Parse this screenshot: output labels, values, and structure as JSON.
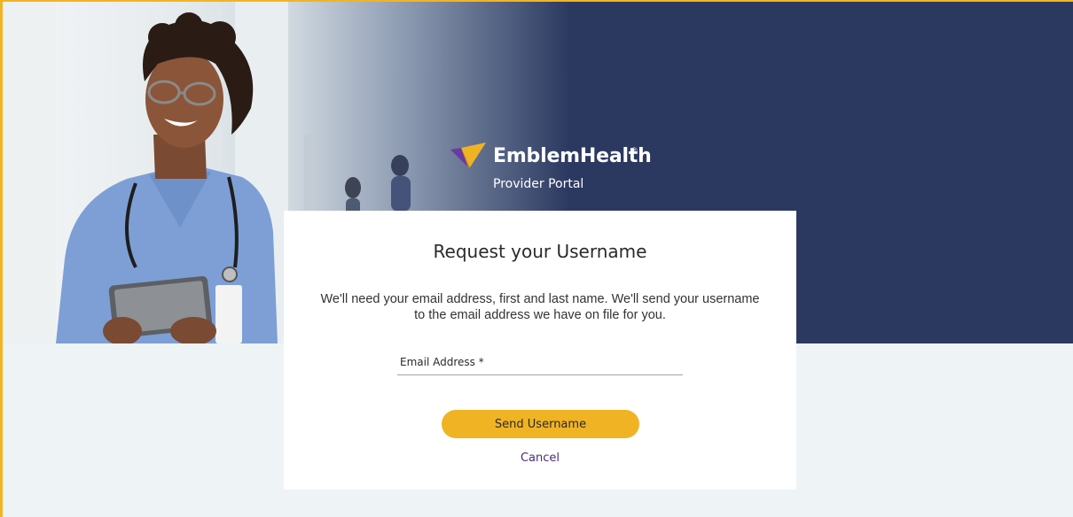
{
  "brand": {
    "name": "EmblemHealth",
    "registered_mark": "®",
    "subtitle": "Provider Portal",
    "colors": {
      "navy": "#2b3961",
      "gold": "#f0b323",
      "purple": "#4b2a7a"
    },
    "logo_icon": "emblem-logo-icon"
  },
  "hero": {
    "photo": "hero-photo-provider-icon"
  },
  "form": {
    "title": "Request your Username",
    "description": "We'll need your email address, first and last name. We'll send your username to the email address we have on file for you.",
    "email_label": "Email Address *",
    "email_value": "",
    "submit_label": "Send Username",
    "cancel_label": "Cancel"
  }
}
